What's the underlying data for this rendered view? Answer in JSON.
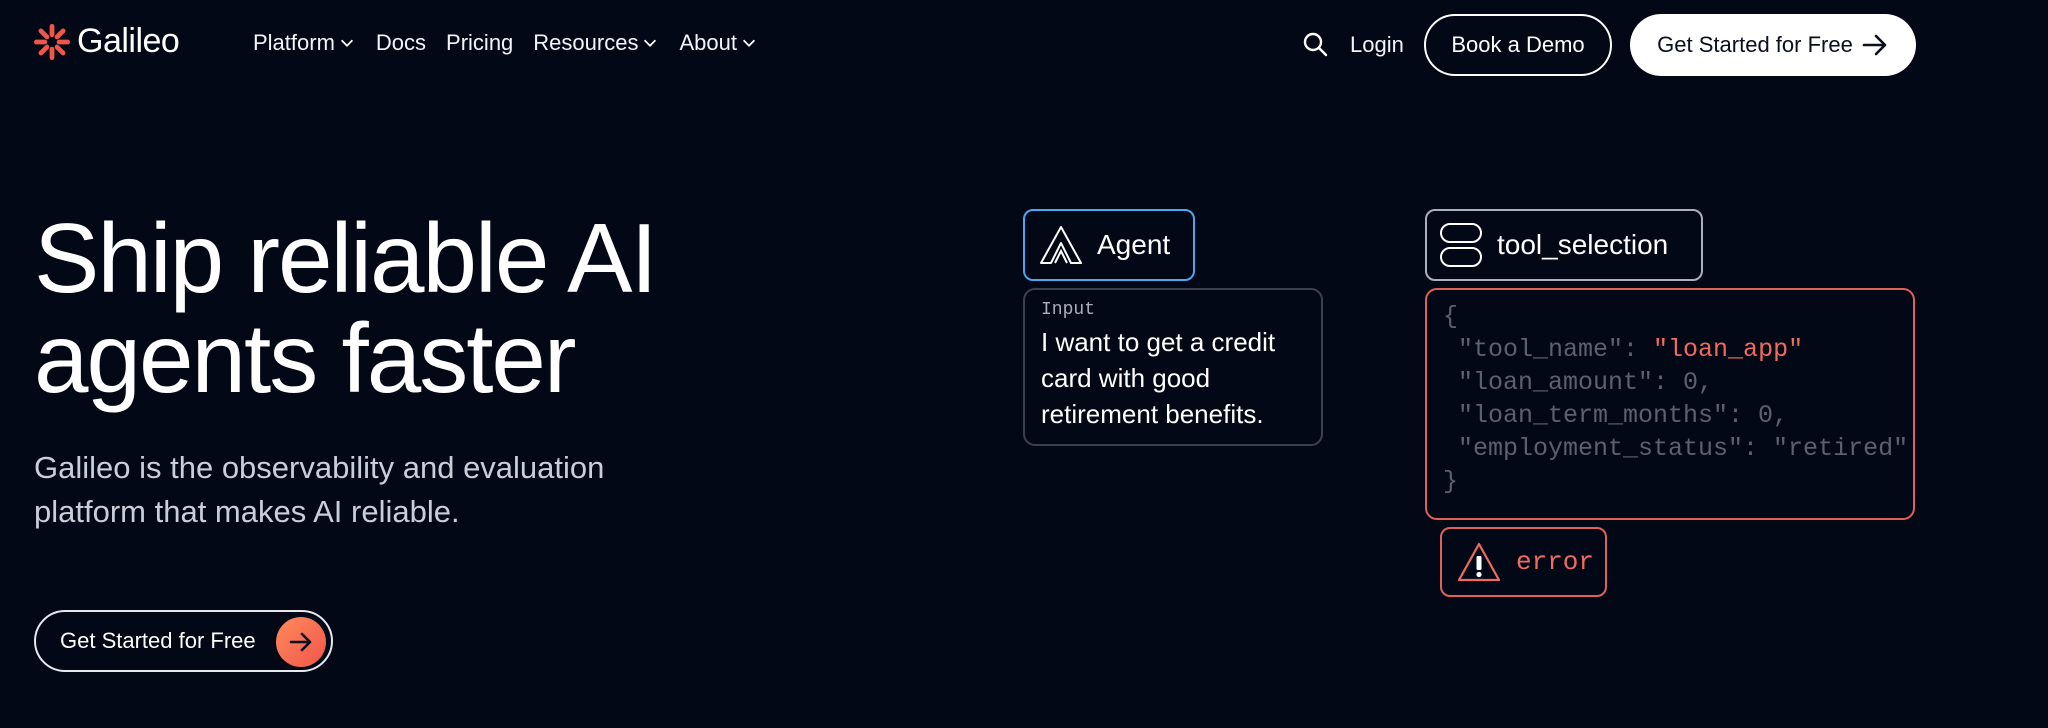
{
  "brand": {
    "name": "Galileo",
    "accent": "#f0564a"
  },
  "nav": {
    "items": [
      {
        "label": "Platform",
        "has_dropdown": true
      },
      {
        "label": "Docs",
        "has_dropdown": false
      },
      {
        "label": "Pricing",
        "has_dropdown": false
      },
      {
        "label": "Resources",
        "has_dropdown": true
      },
      {
        "label": "About",
        "has_dropdown": true
      }
    ],
    "search_icon": "search-icon",
    "login_label": "Login",
    "demo_label": "Book a Demo",
    "free_label": "Get Started for Free"
  },
  "hero": {
    "headline_line1": "Ship reliable AI",
    "headline_line2": "agents faster",
    "sub_line1": "Galileo is the observability and evaluation",
    "sub_line2": "platform that makes AI reliable.",
    "cta_label": "Get Started for Free"
  },
  "visual": {
    "agent_label": "Agent",
    "input_label": "Input",
    "input_text": "I want to get a credit card with good retirement benefits.",
    "tool_label": "tool_selection",
    "json": {
      "open": "{",
      "key1": " \"tool_name\": ",
      "val1": "\"loan_app\"",
      "line2": " \"loan_amount\": 0,",
      "line3": " \"loan_term_months\": 0,",
      "line4": " \"employment_status\": \"retired\"",
      "close": "}"
    },
    "error_label": "error"
  }
}
